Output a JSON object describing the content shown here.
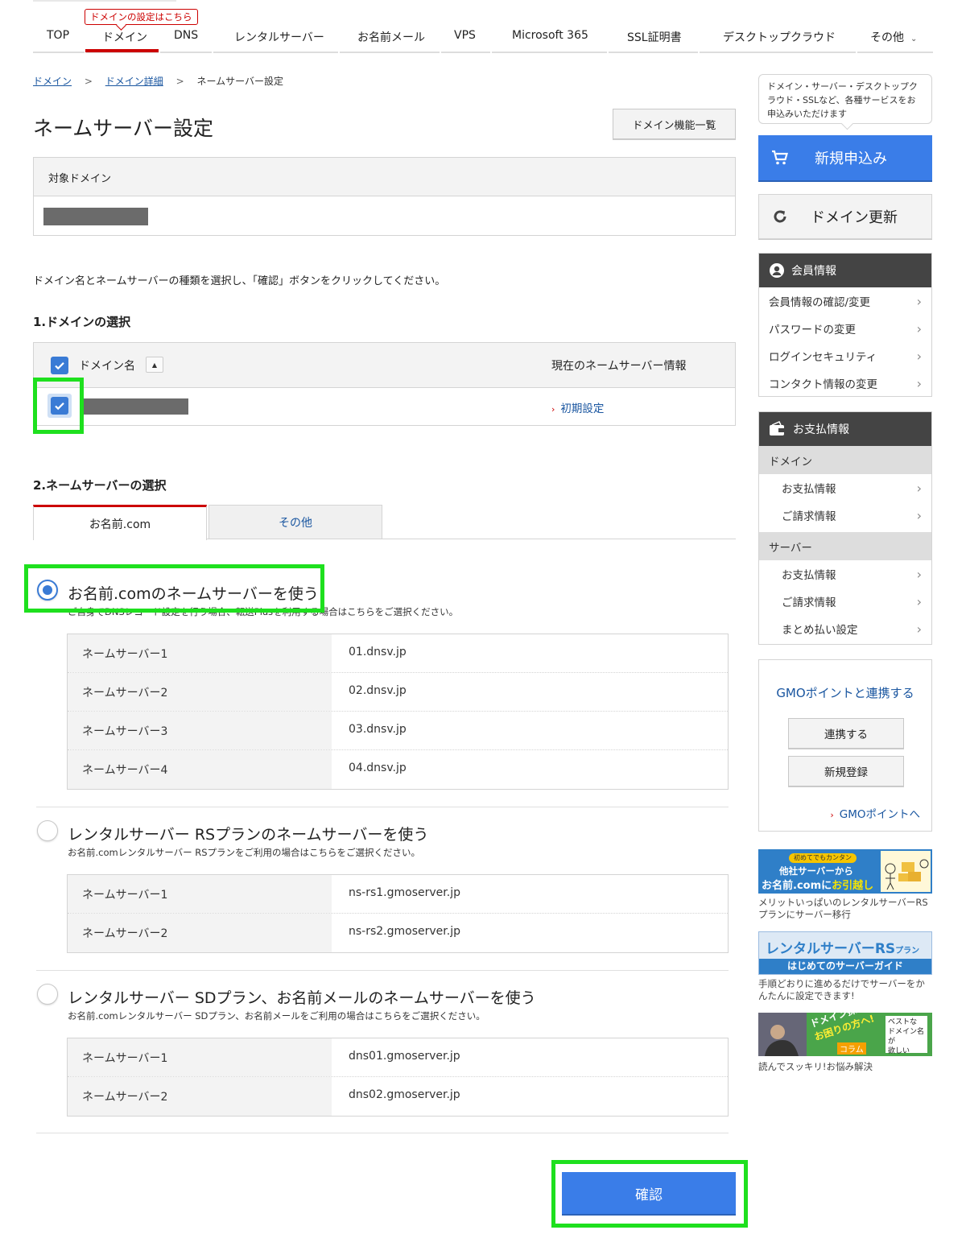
{
  "nav": {
    "tip": "ドメインの設定はこちら",
    "items": [
      "TOP",
      "ドメイン",
      "DNS",
      "レンタルサーバー",
      "お名前メール",
      "VPS",
      "Microsoft 365",
      "SSL証明書",
      "デスクトップクラウド",
      "その他"
    ]
  },
  "breadcrumb": {
    "item1": "ドメイン",
    "item2": "ドメイン詳細",
    "current": "ネームサーバー設定",
    "sep": ">"
  },
  "page": {
    "title": "ネームサーバー設定",
    "features_button": "ドメイン機能一覧"
  },
  "target": {
    "label": "対象ドメイン"
  },
  "instruction": "ドメイン名とネームサーバーの種類を選択し、「確認」ボタンをクリックしてください。",
  "section1": {
    "title": "1.ドメインの選択",
    "col_domain": "ドメイン名",
    "col_ns": "現在のネームサーバー情報",
    "row_ns_link": "初期設定"
  },
  "section2": {
    "title": "2.ネームサーバーの選択",
    "tab_active": "お名前.com",
    "tab_other": "その他"
  },
  "options": [
    {
      "title": "お名前.comのネームサーバーを使う",
      "sub": "ご自身でDNSレコード設定を行う場合、転送Plusを利用する場合はこちらをご選択ください。",
      "rows": [
        {
          "label": "ネームサーバー1",
          "value": "01.dnsv.jp"
        },
        {
          "label": "ネームサーバー2",
          "value": "02.dnsv.jp"
        },
        {
          "label": "ネームサーバー3",
          "value": "03.dnsv.jp"
        },
        {
          "label": "ネームサーバー4",
          "value": "04.dnsv.jp"
        }
      ]
    },
    {
      "title": "レンタルサーバー RSプランのネームサーバーを使う",
      "sub": "お名前.comレンタルサーバー RSプランをご利用の場合はこちらをご選択ください。",
      "rows": [
        {
          "label": "ネームサーバー1",
          "value": "ns-rs1.gmoserver.jp"
        },
        {
          "label": "ネームサーバー2",
          "value": "ns-rs2.gmoserver.jp"
        }
      ]
    },
    {
      "title": "レンタルサーバー SDプラン、お名前メールのネームサーバーを使う",
      "sub": "お名前.comレンタルサーバー SDプラン、お名前メールをご利用の場合はこちらをご選択ください。",
      "rows": [
        {
          "label": "ネームサーバー1",
          "value": "dns01.gmoserver.jp"
        },
        {
          "label": "ネームサーバー2",
          "value": "dns02.gmoserver.jp"
        }
      ]
    }
  ],
  "confirm_button": "確認",
  "sidebar": {
    "note": "ドメイン・サーバー・デスクトップクラウド・SSLなど、各種サービスをお申込みいただけます",
    "apply": "新規申込み",
    "renew": "ドメイン更新",
    "member": {
      "title": "会員情報",
      "items": [
        "会員情報の確認/変更",
        "パスワードの変更",
        "ログインセキュリティ",
        "コンタクト情報の変更"
      ]
    },
    "payment": {
      "title": "お支払情報",
      "group1": "ドメイン",
      "group1_items": [
        "お支払情報",
        "ご請求情報"
      ],
      "group2": "サーバー",
      "group2_items": [
        "お支払情報",
        "ご請求情報",
        "まとめ払い設定"
      ]
    },
    "gmo": {
      "title": "GMOポイントと連携する",
      "link_btn": "連携する",
      "register_btn": "新規登録",
      "link": "GMOポイントへ"
    },
    "banners": [
      {
        "top": "初めてでもカンタン",
        "line1": "他社サーバーから",
        "line2a": "お名前.comに",
        "line2b": "お引越し",
        "caption": "メリットいっぱいのレンタルサーバーRSプランにサーバー移行"
      },
      {
        "line1": "レンタルサーバーRS",
        "line1b": "プラン",
        "line2": "はじめてのサーバーガイド",
        "caption": "手順どおりに進めるだけでサーバーをかんたんに設定できます!"
      },
      {
        "line1": "ドメイン探して",
        "line2": "お困りの方へ!",
        "col": "コラム",
        "side1": "ベストな",
        "side2": "ドメイン名が",
        "side3": "欲しい",
        "caption": "読んでスッキリ!お悩み解決"
      }
    ]
  },
  "colors": {
    "accent_red": "#cc0000",
    "primary_blue": "#3a7de8",
    "link_blue": "#1a56a0",
    "highlight_green": "#1ee01e"
  }
}
